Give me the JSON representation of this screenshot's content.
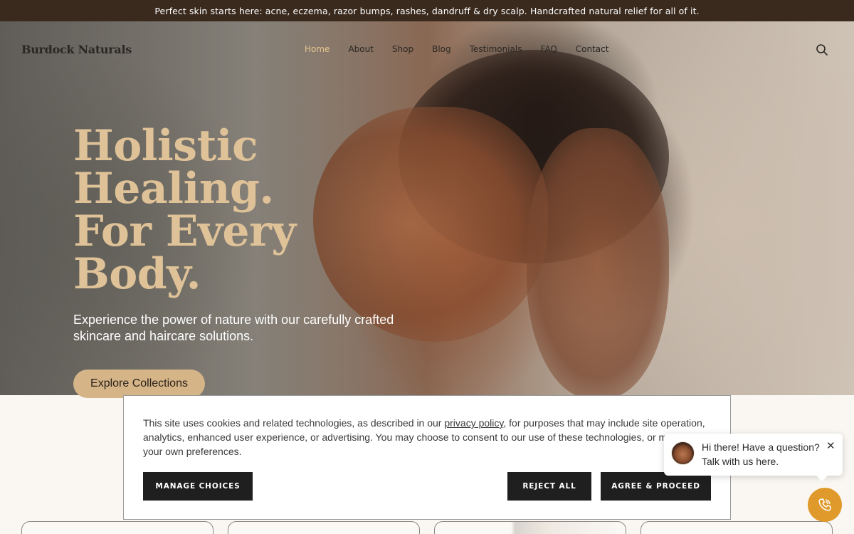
{
  "announcement": "Perfect skin starts here: acne, eczema, razor bumps, rashes, dandruff & dry scalp. Handcrafted natural relief for all of it.",
  "header": {
    "brand": "Burdock Naturals",
    "nav": [
      "Home",
      "About",
      "Shop",
      "Blog",
      "Testimonials",
      "FAQ",
      "Contact"
    ],
    "search_icon": "search-icon"
  },
  "hero": {
    "title_lines": [
      "Holistic",
      "Healing.",
      "For Every",
      "Body."
    ],
    "subtitle": "Experience the power of nature with our carefully crafted skincare and haircare solutions.",
    "cta_label": "Explore Collections"
  },
  "cookie_banner": {
    "text_before_link": "This site uses cookies and related technologies, as described in our ",
    "link_text": "privacy policy",
    "text_after_link": ", for purposes that may include site operation, analytics, enhanced user experience, or advertising. You may choose to consent to our use of these technologies, or manage your own preferences.",
    "manage_label": "MANAGE CHOICES",
    "reject_label": "REJECT ALL",
    "agree_label": "AGREE & PROCEED"
  },
  "chat_widget": {
    "line1": "Hi there! Have a question?",
    "line2": "Talk with us here.",
    "close_glyph": "✕",
    "call_icon": "phone-icon"
  },
  "colors": {
    "announcement_bg": "#3a2a1e",
    "hero_title": "#dfc298",
    "cta_bg": "#d5b488",
    "nav_active": "#e6c48f",
    "call_button": "#e09a2c"
  }
}
